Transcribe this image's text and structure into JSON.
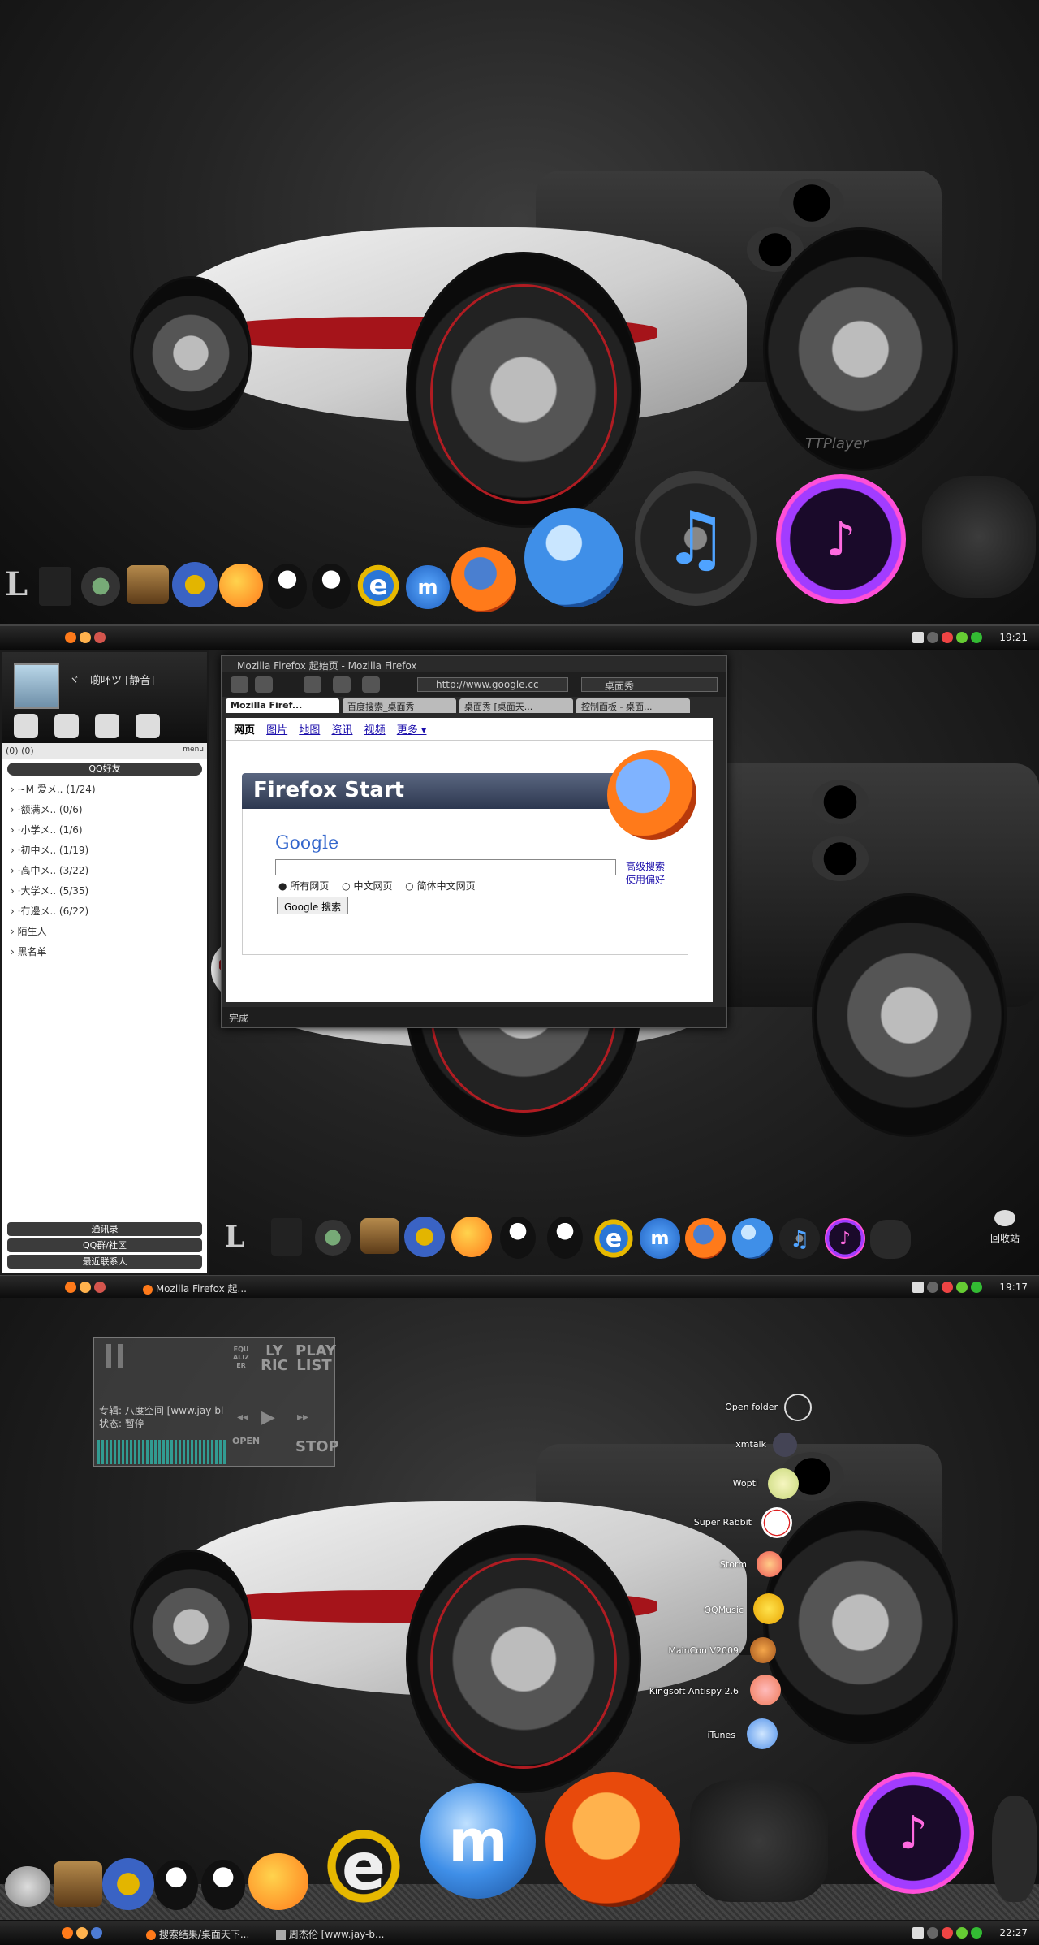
{
  "panel1": {
    "dock_label": "TTPlayer",
    "clock": "19:21"
  },
  "panel2": {
    "qq": {
      "nickname": "ヾ＿啲吥ツ [静音]",
      "status_strip": "(0)  (0)",
      "menu_label": "menu",
      "group_header": "QQ好友",
      "groups": [
        {
          "name": "~M 爱メ..",
          "count": "(1/24)"
        },
        {
          "name": "·额满メ..",
          "count": "(0/6)"
        },
        {
          "name": "·小学メ..",
          "count": "(1/6)"
        },
        {
          "name": "·初中メ..",
          "count": "(1/19)"
        },
        {
          "name": "·高中メ..",
          "count": "(3/22)"
        },
        {
          "name": "·大学メ..",
          "count": "(5/35)"
        },
        {
          "name": "·冇邊メ..",
          "count": "(6/22)"
        },
        {
          "name": "陌生人",
          "count": ""
        },
        {
          "name": "黑名单",
          "count": ""
        }
      ],
      "footer": [
        "通讯录",
        "QQ群/社区",
        "最近联系人"
      ]
    },
    "firefox": {
      "window_title": "Mozilla Firefox 起始页 - Mozilla Firefox",
      "url": "http://www.google.cc",
      "search": "桌面秀",
      "tabs": [
        "Mozilla Firef...",
        "百度搜索_桌面秀",
        "桌面秀 [桌面天...",
        "控制面板 - 桌面..."
      ],
      "links": [
        "网页",
        "图片",
        "地图",
        "资讯",
        "视频",
        "更多 ▾"
      ],
      "start_title": "Firefox Start",
      "google_logo": "Google",
      "radio_all": "所有网页",
      "radio_cn": "中文网页",
      "radio_sc": "简体中文网页",
      "search_button": "Google 搜索",
      "adv_search": "高级搜索",
      "help": "使用偏好",
      "status": "完成"
    },
    "recycle_bin": "回收站",
    "taskbar_task": "Mozilla Firefox 起...",
    "clock": "19:17"
  },
  "panel3": {
    "ttplayer": {
      "song": "专辑: 八度空间 [www.jay-bl",
      "state": "状态: 暂停",
      "equalizer": "EQUALIZER",
      "lyric": "LY RIC",
      "playlist": "PLAY LIST",
      "open": "OPEN",
      "stop": "STOP"
    },
    "stack_items": [
      "Open folder",
      "xmtalk",
      "Wopti",
      "Super Rabbit",
      "Storm",
      "QQMusic",
      "MainCon V2009",
      "Kingsoft Antispy 2.6",
      "iTunes"
    ],
    "taskbar_tasks": [
      "搜索结果/桌面天下...",
      "周杰伦 [www.jay-b..."
    ],
    "clock": "22:27"
  },
  "colors": {
    "accent_red": "#a5141a",
    "firefox_orange": "#ff7a1a",
    "globe_blue": "#3f8fe8"
  }
}
